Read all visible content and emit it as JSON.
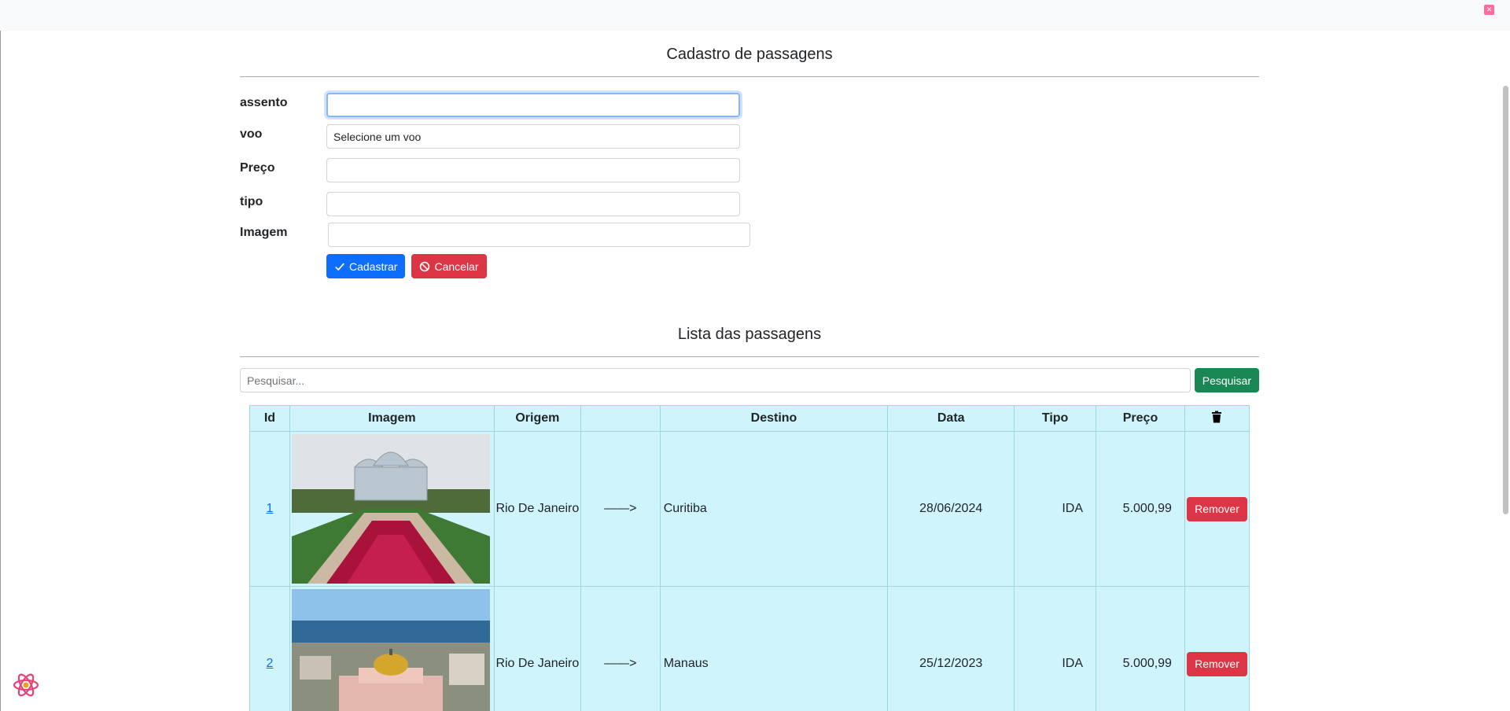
{
  "form": {
    "title": "Cadastro de passagens",
    "fields": [
      {
        "label": "assento",
        "value": "",
        "placeholder": ""
      },
      {
        "label": "voo",
        "value": "Selecione um voo",
        "placeholder": ""
      },
      {
        "label": "Preço",
        "value": "",
        "placeholder": ""
      },
      {
        "label": "tipo",
        "value": "",
        "placeholder": ""
      },
      {
        "label": "Imagem",
        "value": "",
        "placeholder": ""
      }
    ],
    "submit_label": "Cadastrar",
    "cancel_label": "Cancelar"
  },
  "list": {
    "title": "Lista das passagens",
    "search_placeholder": "Pesquisar...",
    "search_button": "Pesquisar",
    "headers": [
      "Id",
      "Imagem",
      "Origem",
      "",
      "Destino",
      "Data",
      "Tipo",
      "Preço"
    ],
    "rows": [
      {
        "id": "1",
        "image": "jardim-botanico-curitiba",
        "origem": "Rio De Janeiro",
        "arrow": "——>",
        "destino": "Curitiba",
        "data": "28/06/2024",
        "tipo": "IDA",
        "preco": "5.000,99",
        "remove": "Remover"
      },
      {
        "id": "2",
        "image": "teatro-amazonas-manaus",
        "origem": "Rio De Janeiro",
        "arrow": "——>",
        "destino": "Manaus",
        "data": "25/12/2023",
        "tipo": "IDA",
        "preco": "5.000,99",
        "remove": "Remover"
      }
    ]
  },
  "icons": {
    "trash": "trash-icon",
    "check": "check-icon",
    "ban": "ban-icon",
    "react": "react-logo-icon"
  },
  "colors": {
    "primary": "#0d6efd",
    "danger": "#dc3545",
    "success": "#198754",
    "table_bg": "#cff4fc"
  }
}
